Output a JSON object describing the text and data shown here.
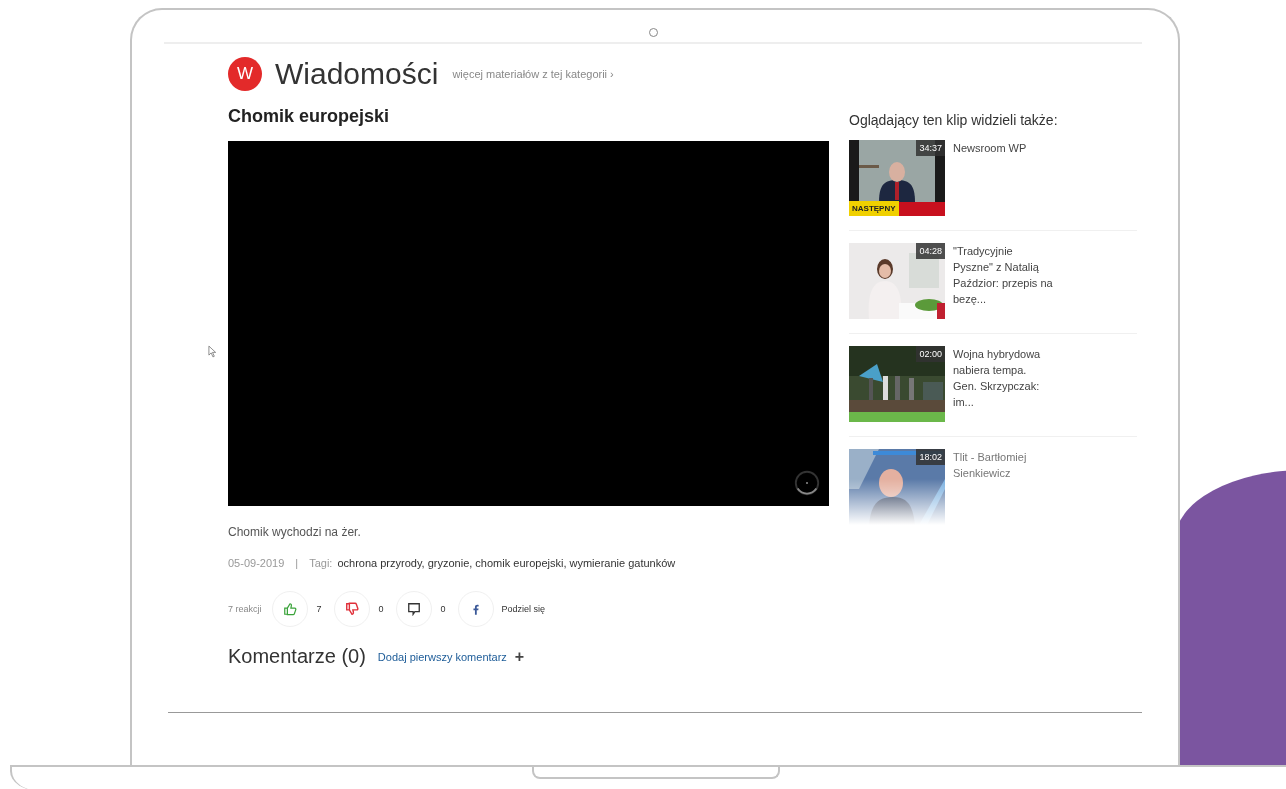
{
  "logo": {
    "letter": "W"
  },
  "section": {
    "title": "Wiadomości",
    "more_link": "więcej materiałów z tej kategorii ›"
  },
  "video": {
    "title": "Chomik europejski",
    "description": "Chomik wychodzi na żer.",
    "date": "05-09-2019",
    "separator": "|",
    "tags_label": "Tagi:",
    "tags": "ochrona przyrody, gryzonie, chomik europejski, wymieranie gatunków"
  },
  "reactions": {
    "summary": "7 reakcji",
    "items": [
      {
        "kind": "like",
        "count": "7"
      },
      {
        "kind": "dislike",
        "count": "0"
      },
      {
        "kind": "comment",
        "count": "0"
      },
      {
        "kind": "facebook",
        "count": "Podziel się"
      }
    ]
  },
  "comments": {
    "title": "Komentarze (0)",
    "add_link": "Dodaj pierwszy komentarz",
    "add_icon": "+"
  },
  "related": {
    "heading": "Oglądający ten klip widzieli także:",
    "items": [
      {
        "duration": "34:37",
        "title": "Newsroom WP",
        "badge": "NASTĘPNY",
        "faded": false
      },
      {
        "duration": "04:28",
        "title": "\"Tradycyjnie Pyszne\" z Natalią Paździor: przepis na bezę...",
        "faded": false
      },
      {
        "duration": "02:00",
        "title": "Wojna hybrydowa nabiera tempa. Gen. Skrzypczak: im...",
        "faded": false
      },
      {
        "duration": "18:02",
        "title": "Tlit - Bartłomiej Sienkiewicz",
        "faded": true
      }
    ]
  }
}
